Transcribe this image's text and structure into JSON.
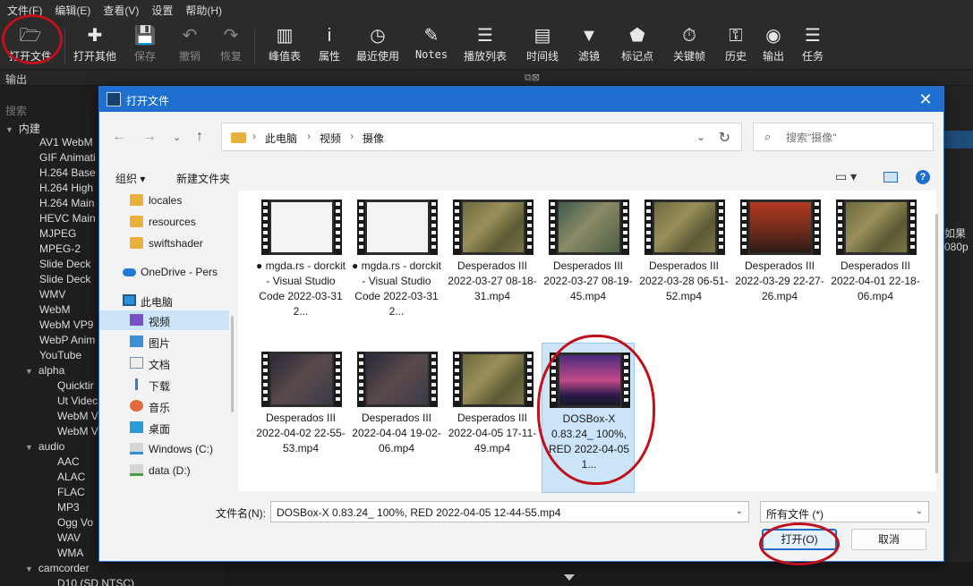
{
  "app": {
    "menu": [
      "文件(F)",
      "编辑(E)",
      "查看(V)",
      "设置",
      "帮助(H)"
    ],
    "toolbar": [
      {
        "label": "打开文件",
        "icon": "folder-open-icon",
        "glyph": "🗁",
        "disabled": false
      },
      {
        "label": "打开其他",
        "icon": "plus-file-icon",
        "glyph": "✚",
        "disabled": false
      },
      {
        "label": "保存",
        "icon": "save-icon",
        "glyph": "💾",
        "disabled": true
      },
      {
        "label": "撤销",
        "icon": "undo-icon",
        "glyph": "↶",
        "disabled": true
      },
      {
        "label": "恢复",
        "icon": "redo-icon",
        "glyph": "↷",
        "disabled": true
      },
      {
        "label": "峰值表",
        "icon": "meter-icon",
        "glyph": "▥",
        "disabled": false
      },
      {
        "label": "属性",
        "icon": "info-icon",
        "glyph": "i",
        "disabled": false
      },
      {
        "label": "最近使用",
        "icon": "clock-icon",
        "glyph": "◷",
        "disabled": false
      },
      {
        "label": "Notes",
        "icon": "notes-icon",
        "glyph": "✎",
        "disabled": false
      },
      {
        "label": "播放列表",
        "icon": "list-icon",
        "glyph": "☰",
        "disabled": false
      },
      {
        "label": "时间线",
        "icon": "timeline-icon",
        "glyph": "▤",
        "disabled": false
      },
      {
        "label": "滤镜",
        "icon": "filter-icon",
        "glyph": "▼",
        "disabled": false
      },
      {
        "label": "标记点",
        "icon": "marker-icon",
        "glyph": "⬟",
        "disabled": false
      },
      {
        "label": "关键帧",
        "icon": "stopwatch-icon",
        "glyph": "⏱",
        "disabled": false
      },
      {
        "label": "历史",
        "icon": "history-icon",
        "glyph": "⚿",
        "disabled": false
      },
      {
        "label": "输出",
        "icon": "export-icon",
        "glyph": "◉",
        "disabled": false
      },
      {
        "label": "任务",
        "icon": "jobs-icon",
        "glyph": "☰",
        "disabled": false
      }
    ],
    "output_title": "输出",
    "side_search_placeholder": "搜索",
    "side_tree": [
      {
        "text": "内建",
        "level": 0,
        "group": true
      },
      {
        "text": "AV1 WebM",
        "level": 1
      },
      {
        "text": "GIF Animati",
        "level": 1
      },
      {
        "text": "H.264 Base",
        "level": 1
      },
      {
        "text": "H.264 High",
        "level": 1
      },
      {
        "text": "H.264 Main",
        "level": 1
      },
      {
        "text": "HEVC Main",
        "level": 1
      },
      {
        "text": "MJPEG",
        "level": 1
      },
      {
        "text": "MPEG-2",
        "level": 1
      },
      {
        "text": "Slide Deck",
        "level": 1
      },
      {
        "text": "Slide Deck",
        "level": 1
      },
      {
        "text": "WMV",
        "level": 1
      },
      {
        "text": "WebM",
        "level": 1
      },
      {
        "text": "WebM VP9",
        "level": 1
      },
      {
        "text": "WebP Anim",
        "level": 1
      },
      {
        "text": "YouTube",
        "level": 1
      },
      {
        "text": "alpha",
        "level": 1,
        "group": true
      },
      {
        "text": "Quicktir",
        "level": 2
      },
      {
        "text": "Ut Videc",
        "level": 2
      },
      {
        "text": "WebM V",
        "level": 2
      },
      {
        "text": "WebM V",
        "level": 2
      },
      {
        "text": "audio",
        "level": 1,
        "group": true
      },
      {
        "text": "AAC",
        "level": 2
      },
      {
        "text": "ALAC",
        "level": 2
      },
      {
        "text": "FLAC",
        "level": 2
      },
      {
        "text": "MP3",
        "level": 2
      },
      {
        "text": "Ogg Vo",
        "level": 2
      },
      {
        "text": "WAV",
        "level": 2
      },
      {
        "text": "WMA",
        "level": 2
      },
      {
        "text": "camcorder",
        "level": 1,
        "group": true
      },
      {
        "text": "D10 (SD NTSC)",
        "level": 2
      }
    ],
    "right_text": "如果\n080p"
  },
  "dialog": {
    "title": "打开文件",
    "close_glyph": "✕",
    "breadcrumb": [
      "此电脑",
      "视频",
      "摄像"
    ],
    "search_placeholder": "搜索\"摄像\"",
    "organize": "组织 ▾",
    "new_folder": "新建文件夹",
    "help": "?",
    "nav_items": [
      {
        "label": "locales",
        "icon": "folder-icon",
        "sel": false
      },
      {
        "label": "resources",
        "icon": "folder-icon",
        "sel": false
      },
      {
        "label": "swiftshader",
        "icon": "folder-icon",
        "sel": false
      },
      {
        "label": "OneDrive - Pers",
        "icon": "cloud-icon",
        "sel": false
      },
      {
        "label": "此电脑",
        "icon": "pc-icon",
        "sel": false
      },
      {
        "label": "视频",
        "icon": "video-icon",
        "sel": true
      },
      {
        "label": "图片",
        "icon": "picture-icon",
        "sel": false
      },
      {
        "label": "文档",
        "icon": "document-icon",
        "sel": false
      },
      {
        "label": "下载",
        "icon": "download-icon",
        "sel": false
      },
      {
        "label": "音乐",
        "icon": "music-icon",
        "sel": false
      },
      {
        "label": "桌面",
        "icon": "desktop-icon",
        "sel": false
      },
      {
        "label": "Windows (C:)",
        "icon": "drive-c-icon",
        "sel": false
      },
      {
        "label": "data (D:)",
        "icon": "drive-d-icon",
        "sel": false
      }
    ],
    "files": [
      {
        "name": "● mgda.rs - dorckit - Visual Studio Code 2022-03-31 2...",
        "thumb": "vscode",
        "sel": false
      },
      {
        "name": "● mgda.rs - dorckit - Visual Studio Code 2022-03-31 2...",
        "thumb": "vscode",
        "sel": false
      },
      {
        "name": "Desperados III 2022-03-27 08-18-31.mp4",
        "thumb": "map",
        "sel": false
      },
      {
        "name": "Desperados III 2022-03-27 08-19-45.mp4",
        "thumb": "town",
        "sel": false
      },
      {
        "name": "Desperados III 2022-03-28 06-51-52.mp4",
        "thumb": "map",
        "sel": false
      },
      {
        "name": "Desperados III 2022-03-29 22-27-26.mp4",
        "thumb": "title",
        "sel": false
      },
      {
        "name": "Desperados III 2022-04-01 22-18-06.mp4",
        "thumb": "map",
        "sel": false
      },
      {
        "name": "Desperados III 2022-04-02 22-55-53.mp4",
        "thumb": "dark",
        "sel": false
      },
      {
        "name": "Desperados III 2022-04-04 19-02-06.mp4",
        "thumb": "dark",
        "sel": false
      },
      {
        "name": "Desperados III 2022-04-05 17-11-49.mp4",
        "thumb": "map",
        "sel": false
      },
      {
        "name": "DOSBox-X 0.83.24_ 100%, RED 2022-04-05 1...",
        "thumb": "dosbox",
        "sel": true
      }
    ],
    "filename_label": "文件名(N):",
    "filename_value": "DOSBox-X 0.83.24_ 100%, RED 2022-04-05 12-44-55.mp4",
    "filetype": "所有文件 (*)",
    "open_button": "打开(O)",
    "cancel_button": "取消",
    "accent": "#1f6fd1",
    "annotation_color": "#c0101c"
  }
}
